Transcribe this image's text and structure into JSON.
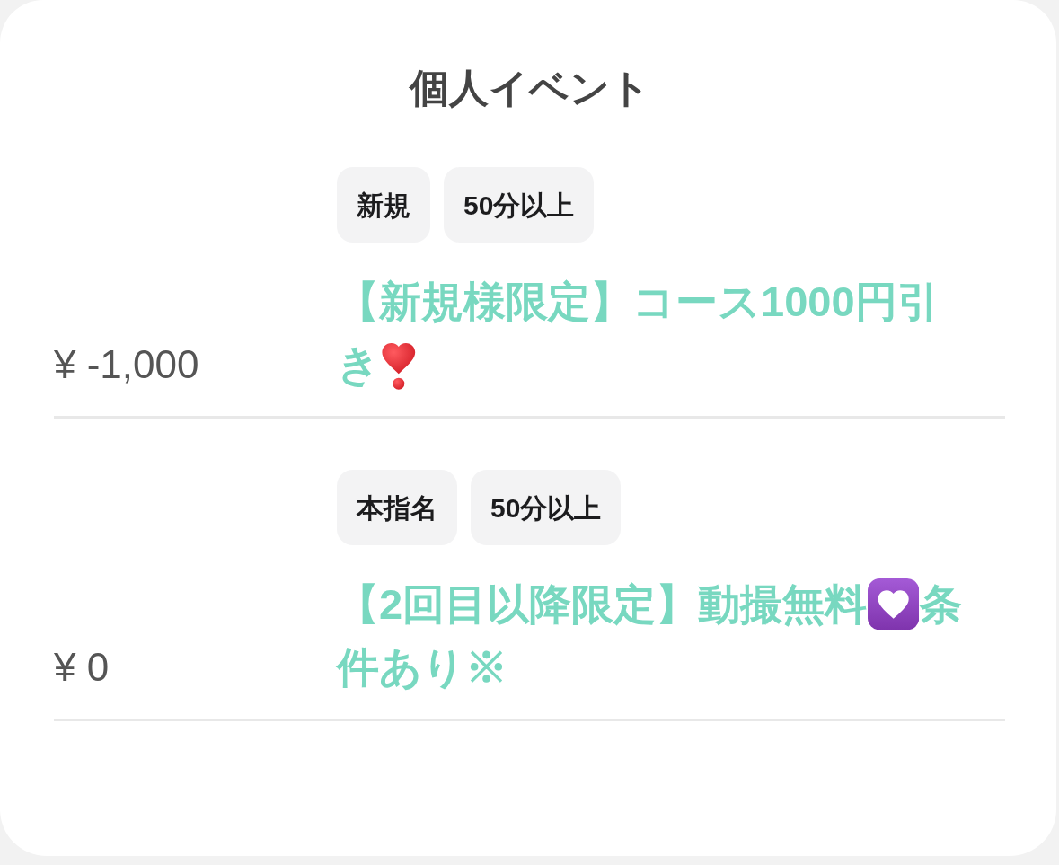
{
  "title": "個人イベント",
  "events": [
    {
      "price": "¥ -1,000",
      "tags": [
        "新規",
        "50分以上"
      ],
      "description": [
        {
          "kind": "text",
          "text": "【新規様限定】コース1000円引き"
        },
        {
          "kind": "exclaim_heart"
        }
      ]
    },
    {
      "price": "¥ 0",
      "tags": [
        "本指名",
        "50分以上"
      ],
      "description": [
        {
          "kind": "text",
          "text": "【2回目以降限定】動撮無料"
        },
        {
          "kind": "heart_tile"
        },
        {
          "kind": "text",
          "text": "条件あり※"
        }
      ]
    }
  ]
}
